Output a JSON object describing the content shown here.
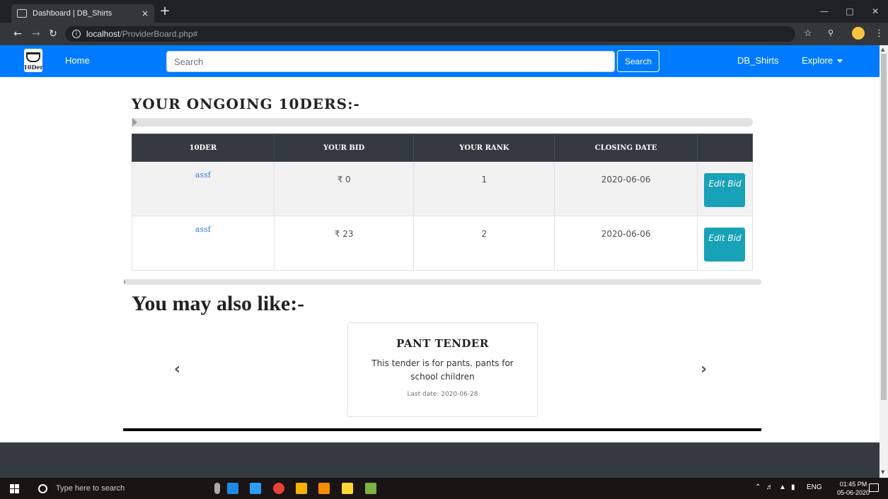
{
  "browser": {
    "tab_title": "Dashboard | DB_Shirts",
    "tab_close": "×",
    "new_tab": "+",
    "url_host": "localhost",
    "url_path": "/ProviderBoard.php#"
  },
  "navbar": {
    "logo_text": "10Der",
    "home": "Home",
    "search_placeholder": "Search",
    "search_button": "Search",
    "brand": "DB_Shirts",
    "explore": "Explore"
  },
  "ongoing": {
    "heading": "YOUR ONGOING 10DERS:-",
    "columns": [
      "10DER",
      "YOUR BID",
      "YOUR RANK",
      "CLOSING DATE",
      ""
    ],
    "rows": [
      {
        "name": "assf",
        "bid": "₹ 0",
        "rank": "1",
        "closing": "2020-06-06",
        "action": "Edit Bid"
      },
      {
        "name": "assf",
        "bid": "₹ 23",
        "rank": "2",
        "closing": "2020-06-06",
        "action": "Edit Bid"
      }
    ]
  },
  "suggest": {
    "heading": "You may also like:-",
    "prev": "‹",
    "next": "›",
    "card": {
      "title": "PANT TENDER",
      "text": "This tender is for pants. pants for school children",
      "date": "Last date: 2020-06-28"
    }
  },
  "taskbar": {
    "search_text": "Type here to search",
    "lang": "ENG",
    "time": "01:45 PM",
    "date": "05-06-2020"
  },
  "colors": {
    "navbar": "#007bff",
    "table_header": "#343a40",
    "edit_button": "#17a2b8",
    "link": "#2f7ed8"
  }
}
